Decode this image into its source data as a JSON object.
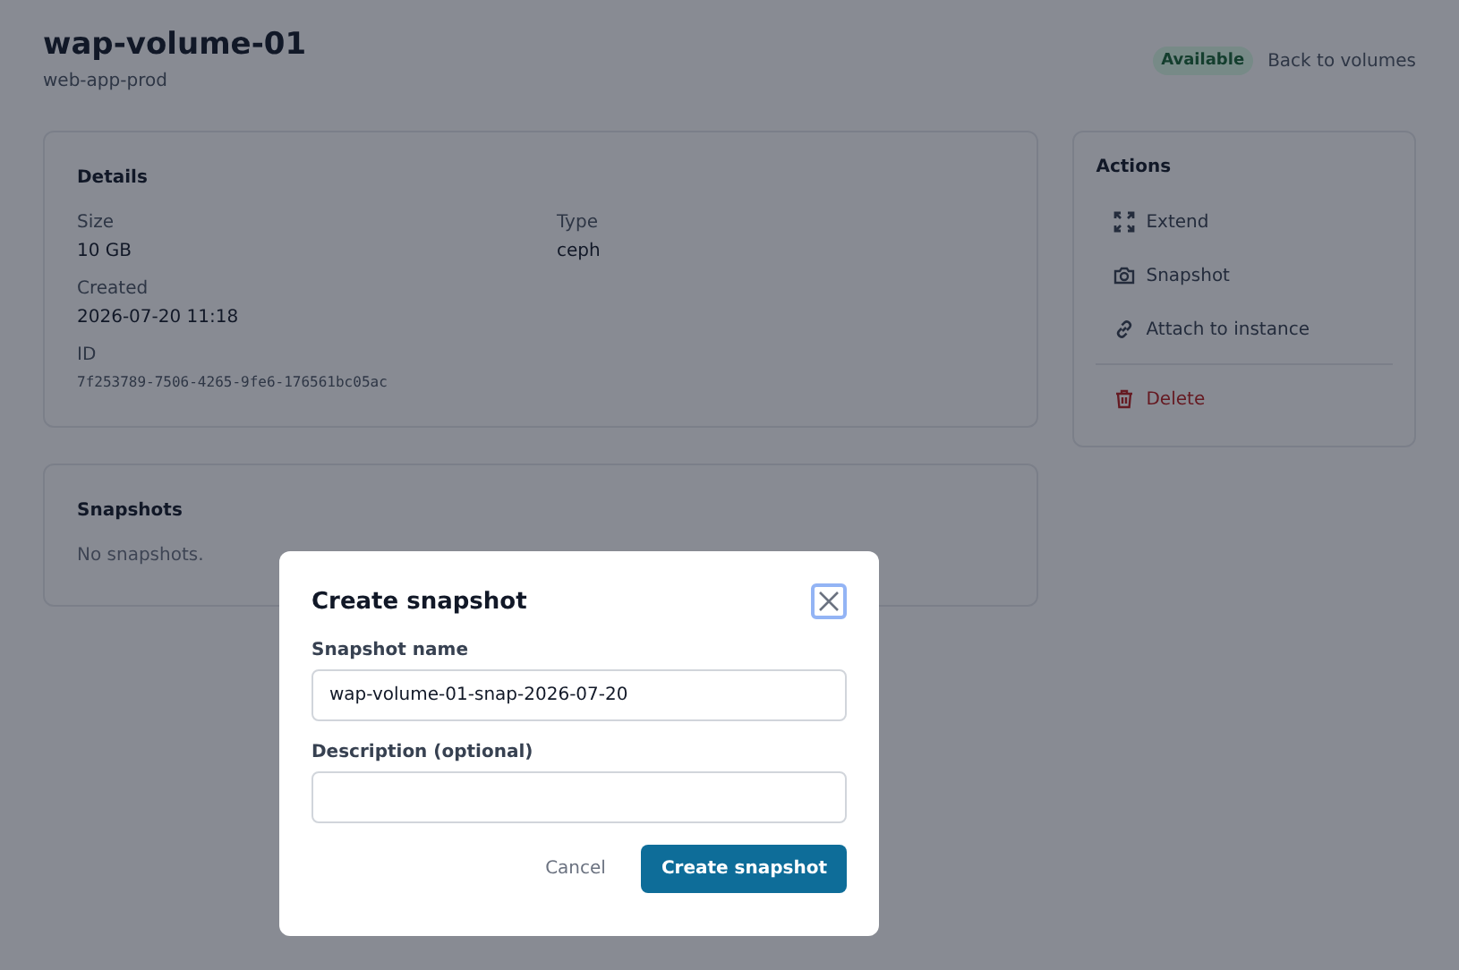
{
  "header": {
    "title": "wap-volume-01",
    "subtitle": "web-app-prod",
    "status": "Available",
    "back_link": "Back to volumes"
  },
  "details": {
    "title": "Details",
    "fields": [
      {
        "label": "Size",
        "value": "10 GB",
        "kind": "text"
      },
      {
        "label": "Type",
        "value": "ceph",
        "kind": "text"
      },
      {
        "label": "Created",
        "value": "2026-07-20 11:18",
        "kind": "text"
      },
      {
        "label": "ID",
        "value": "7f253789-7506-4265-9fe6-176561bc05ac",
        "kind": "mono"
      }
    ]
  },
  "actions": {
    "title": "Actions",
    "items": [
      {
        "label": "Extend",
        "kind": "extend"
      },
      {
        "label": "Snapshot",
        "kind": "snapshot"
      },
      {
        "label": "Attach to instance",
        "kind": "attach"
      },
      {
        "label": "Delete",
        "kind": "delete"
      }
    ]
  },
  "snapshots": {
    "title": "Snapshots",
    "empty_text": "No snapshots."
  },
  "dialog": {
    "title": "Create snapshot",
    "fields": [
      {
        "label": "Snapshot name",
        "value": "wap-volume-01-snap-2026-07-20"
      },
      {
        "label": "Description (optional)"
      }
    ],
    "cancel": "Cancel",
    "submit": "Create snapshot"
  }
}
